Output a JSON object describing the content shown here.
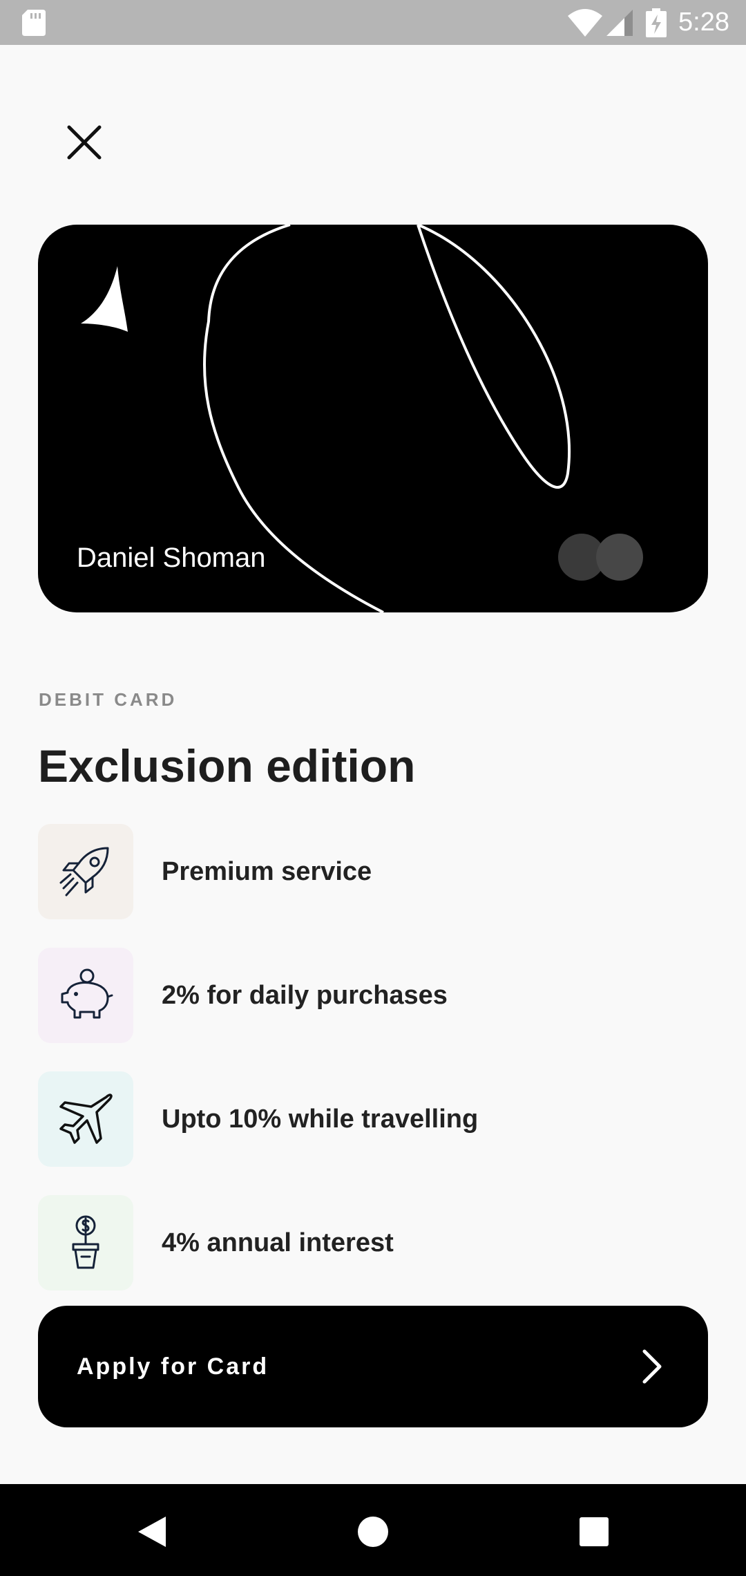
{
  "status_bar": {
    "time": "5:28",
    "icons": [
      "sd-card-icon",
      "wifi-icon",
      "cell-signal-icon",
      "battery-charging-icon"
    ]
  },
  "header": {
    "close_icon": "close-icon"
  },
  "card": {
    "holder_name": "Daniel Shoman",
    "logo_icon": "brand-logo-icon",
    "network_icon": "card-network-icon",
    "color": "#000000"
  },
  "product": {
    "type_label": "DEBIT CARD",
    "title": "Exclusion edition"
  },
  "features": [
    {
      "label": "Premium service",
      "icon": "rocket-icon",
      "bg": "#f4f0ec"
    },
    {
      "label": "2% for daily purchases",
      "icon": "piggy-bank-icon",
      "bg": "#f6eff7"
    },
    {
      "label": "Upto 10% while travelling",
      "icon": "airplane-icon",
      "bg": "#e9f5f5"
    },
    {
      "label": "4% annual interest",
      "icon": "money-plant-icon",
      "bg": "#eff7ef"
    }
  ],
  "cta": {
    "label": "Apply for Card",
    "icon": "chevron-right-icon"
  },
  "nav_bar": {
    "icons": [
      "back-icon",
      "home-icon",
      "recents-icon"
    ]
  }
}
